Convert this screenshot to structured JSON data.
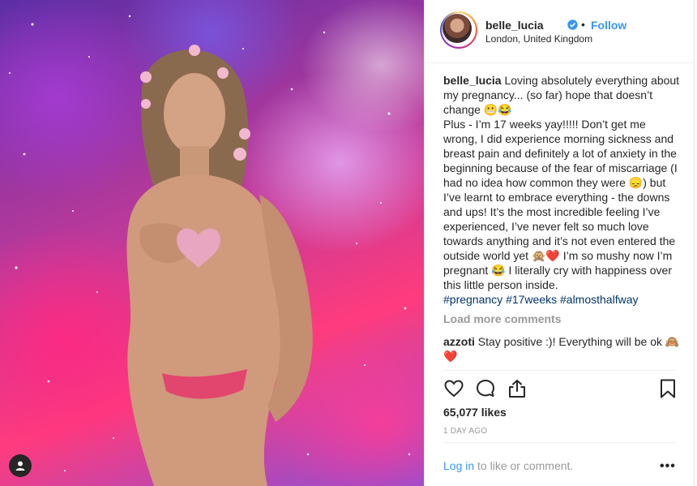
{
  "post": {
    "username": "belle_lucia",
    "follow_label": "Follow",
    "dot": "•",
    "location": "London, United Kingdom",
    "caption_text": " Loving absolutely everything about my pregnancy... (so far) hope that doesn’t change 😬😂\nPlus - I’m 17 weeks yay!!!!! Don’t get me wrong, I did experience morning sickness and breast pain and definitely a lot of anxiety in the beginning because of the fear of miscarriage (I had no idea how common they were 😞) but I’ve learnt to embrace everything - the downs and ups! It’s the most incredible feeling I’ve experienced, I’ve never felt so much love towards anything and it’s not even entered the outside world yet 🙊❤️ I’m so mushy now I’m pregnant 😂 I literally cry with happiness over this little person inside.",
    "hashtags": [
      "#pregnancy",
      "#17weeks",
      "#almosthalfway"
    ],
    "load_more": "Load more comments",
    "comments": [
      {
        "user": "azzoti",
        "text": " Stay positive :)! Everything will be ok 🙈❤️"
      }
    ],
    "likes": "65,077 likes",
    "time": "1 DAY AGO",
    "login_link": "Log in",
    "login_rest": " to like or comment.",
    "more_label": "•••"
  },
  "colors": {
    "link_blue": "#3897f0",
    "hashtag": "#003569",
    "muted": "#999999",
    "text": "#262626"
  },
  "icons": {
    "verified": "verified-badge-icon",
    "like": "heart-icon",
    "comment": "comment-bubble-icon",
    "share": "share-icon",
    "save": "bookmark-icon",
    "user": "user-silhouette-icon"
  }
}
